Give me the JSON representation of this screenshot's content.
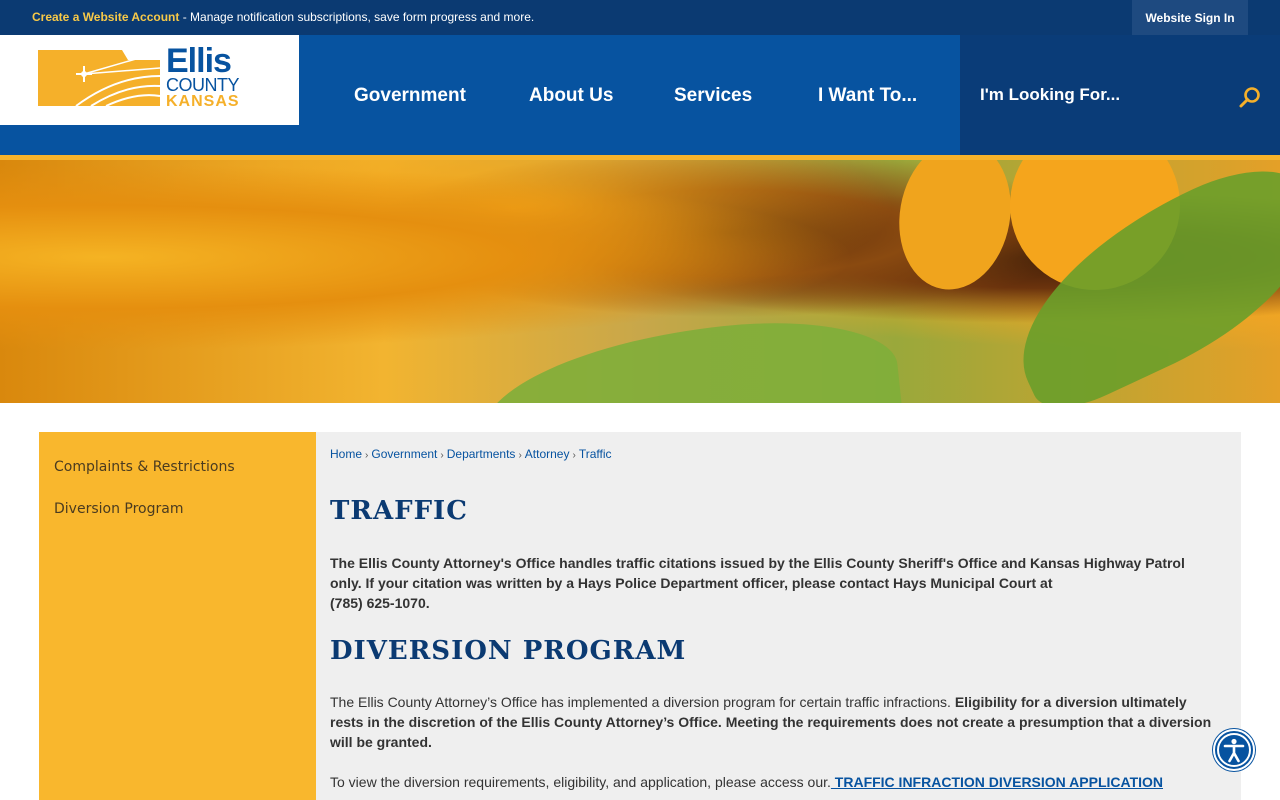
{
  "topbar": {
    "create_link": "Create a Website Account",
    "message": " - Manage notification subscriptions, save form progress and more.",
    "signin_label": "Website Sign In"
  },
  "logo": {
    "line1": "Ellis",
    "line2": "COUNTY",
    "line3": "KANSAS"
  },
  "nav": {
    "items": [
      {
        "label": "Government"
      },
      {
        "label": "About Us"
      },
      {
        "label": "Services"
      },
      {
        "label": "I Want To..."
      }
    ]
  },
  "search": {
    "placeholder": "I'm Looking For...",
    "icon": "search-icon"
  },
  "sidebar": {
    "items": [
      {
        "label": "Complaints & Restrictions"
      },
      {
        "label": "Diversion Program"
      }
    ]
  },
  "breadcrumb": {
    "items": [
      "Home",
      "Government",
      "Departments",
      "Attorney",
      "Traffic"
    ]
  },
  "content": {
    "title": "TRAFFIC",
    "intro_line1": "The Ellis County Attorney's Office handles traffic citations issued by the Ellis County Sheriff's Office and Kansas Highway Patrol",
    "intro_line2": "only. If your citation was written by a Hays Police Department officer, please contact Hays Municipal Court at",
    "intro_line3": "(785) 625-1070.",
    "section_title": "DIVERSION PROGRAM",
    "diversion_normal": "The Ellis County Attorney’s Office has implemented a diversion program for certain traffic infractions. ",
    "diversion_bold": "Eligibility for a diversion ultimately rests in the discretion of the Ellis County Attorney’s Office. Meeting the requirements does not create a presumption that a diversion will be granted.",
    "view_text": "To view the diversion requirements, eligibility, and application, please access our.",
    "view_link": " TRAFFIC INFRACTION DIVERSION APPLICATION"
  },
  "colors": {
    "navy": "#0b3a72",
    "brand_blue": "#0753a0",
    "gold": "#f9b72d"
  }
}
